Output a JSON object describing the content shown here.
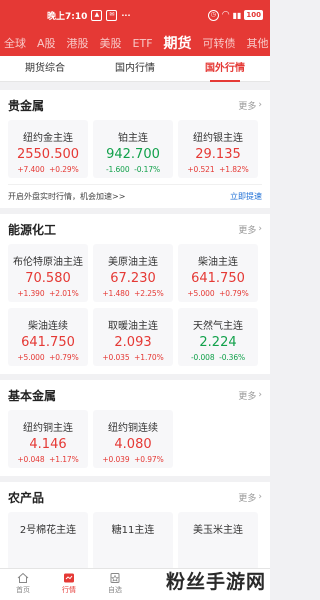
{
  "status_bar": {
    "time": "晚上7:10",
    "battery": "100"
  },
  "market_tabs": [
    "全球",
    "A股",
    "港股",
    "美股",
    "ETF",
    "期货",
    "可转债",
    "其他"
  ],
  "sub_tabs": [
    "期货综合",
    "国内行情",
    "国外行情"
  ],
  "more_label": "更多",
  "sections": [
    {
      "title": "贵金属",
      "rows": [
        [
          {
            "name": "纽约金主连",
            "price": "2550.500",
            "change": "+7.400",
            "pct": "+0.29%",
            "trend": "up"
          },
          {
            "name": "铂主连",
            "price": "942.700",
            "change": "-1.600",
            "pct": "-0.17%",
            "trend": "down"
          },
          {
            "name": "纽约银主连",
            "price": "29.135",
            "change": "+0.521",
            "pct": "+1.82%",
            "trend": "up"
          }
        ]
      ],
      "notice": "开启外盘实时行情，机会加速>>",
      "notice_link": "立即提速"
    },
    {
      "title": "能源化工",
      "rows": [
        [
          {
            "name": "布伦特原油主连",
            "price": "70.580",
            "change": "+1.390",
            "pct": "+2.01%",
            "trend": "up"
          },
          {
            "name": "美原油主连",
            "price": "67.230",
            "change": "+1.480",
            "pct": "+2.25%",
            "trend": "up"
          },
          {
            "name": "柴油主连",
            "price": "641.750",
            "change": "+5.000",
            "pct": "+0.79%",
            "trend": "up"
          }
        ],
        [
          {
            "name": "柴油连续",
            "price": "641.750",
            "change": "+5.000",
            "pct": "+0.79%",
            "trend": "up"
          },
          {
            "name": "取暖油主连",
            "price": "2.093",
            "change": "+0.035",
            "pct": "+1.70%",
            "trend": "up"
          },
          {
            "name": "天然气主连",
            "price": "2.224",
            "change": "-0.008",
            "pct": "-0.36%",
            "trend": "down"
          }
        ]
      ]
    },
    {
      "title": "基本金属",
      "rows": [
        [
          {
            "name": "纽约铜主连",
            "price": "4.146",
            "change": "+0.048",
            "pct": "+1.17%",
            "trend": "up"
          },
          {
            "name": "纽约铜连续",
            "price": "4.080",
            "change": "+0.039",
            "pct": "+0.97%",
            "trend": "up"
          }
        ]
      ]
    },
    {
      "title": "农产品",
      "rows": [
        [
          {
            "name": "2号棉花主连",
            "price": "",
            "change": "",
            "pct": "",
            "trend": "up"
          },
          {
            "name": "糖11主连",
            "price": "",
            "change": "",
            "pct": "",
            "trend": "up"
          },
          {
            "name": "美玉米主连",
            "price": "",
            "change": "",
            "pct": "",
            "trend": "up"
          }
        ]
      ]
    }
  ],
  "bottom_nav": [
    "首页",
    "行情",
    "自选"
  ],
  "watermark": "粉丝手游网",
  "colors": {
    "accent": "#e53935",
    "up": "#e53935",
    "down": "#12a14b",
    "link": "#1e6fd6"
  }
}
